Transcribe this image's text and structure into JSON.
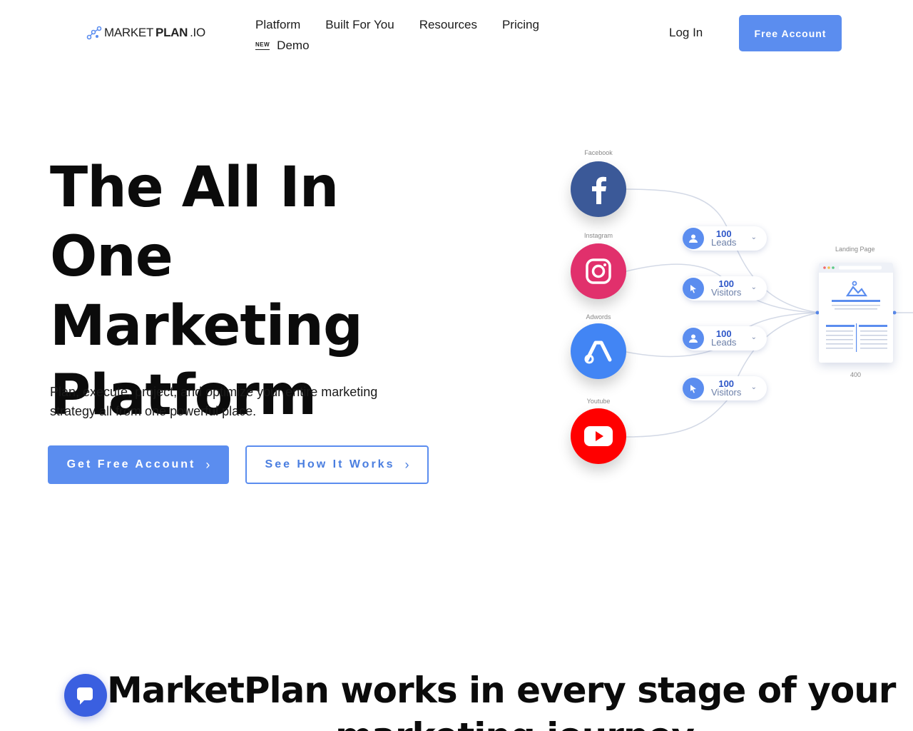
{
  "header": {
    "logo_text_light": "MARKET",
    "logo_text_bold": "PLAN",
    "logo_text_suffix": ".IO",
    "nav": [
      "Platform",
      "Built For You",
      "Resources",
      "Pricing"
    ],
    "new_badge": "NEW",
    "demo_label": "Demo",
    "login_label": "Log In",
    "cta_label": "Free Account"
  },
  "hero": {
    "title_lines": [
      "The All In One",
      "Marketing",
      "Platform"
    ],
    "subtitle": "Plan, execute, project, and optimize your entire marketing strategy all from one powerful place.",
    "primary_button": "Get Free Account",
    "secondary_button": "See How It Works"
  },
  "diagram": {
    "sources": [
      {
        "label": "Facebook",
        "icon": "facebook-icon",
        "color": "#3b5998"
      },
      {
        "label": "Instagram",
        "icon": "instagram-icon",
        "color": "#e1306c"
      },
      {
        "label": "Adwords",
        "icon": "adwords-icon",
        "color": "#4285f4"
      },
      {
        "label": "Youtube",
        "icon": "youtube-icon",
        "color": "#ff0000"
      }
    ],
    "pills": [
      {
        "value": "100",
        "unit": "Leads",
        "icon": "user-icon"
      },
      {
        "value": "100",
        "unit": "Visitors",
        "icon": "cursor-icon"
      },
      {
        "value": "100",
        "unit": "Leads",
        "icon": "user-icon"
      },
      {
        "value": "100",
        "unit": "Visitors",
        "icon": "cursor-icon"
      }
    ],
    "landing_label": "Landing Page",
    "landing_count": "400"
  },
  "section": {
    "title_line1": "MarketPlan works in every stage of your",
    "title_line2": "marketing journey"
  },
  "colors": {
    "accent": "#5b8def",
    "chat": "#3a5fe0"
  }
}
